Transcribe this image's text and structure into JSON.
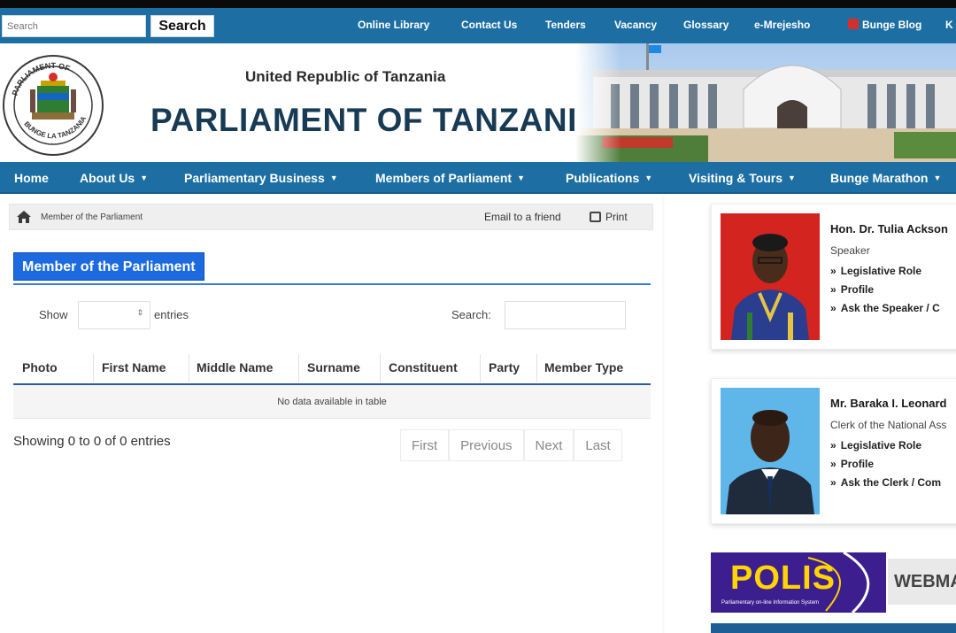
{
  "topbar": {
    "search_placeholder": "Search",
    "search_button": "Search",
    "links": [
      "Online Library",
      "Contact Us",
      "Tenders",
      "Vacancy",
      "Glossary",
      "e-Mrejesho",
      "Bunge Blog",
      "K"
    ]
  },
  "header": {
    "country": "United Republic of Tanzania",
    "title": "PARLIAMENT OF TANZANIA",
    "seal_text": "BUNGE LA TANZANIA",
    "seal_top_text": "PARLIAMENT OF"
  },
  "mainnav": {
    "items": [
      "Home",
      "About Us",
      "Parliamentary Business",
      "Members of Parliament",
      "Publications",
      "Visiting & Tours",
      "Bunge Marathon"
    ]
  },
  "breadcrumb": {
    "current": "Member of the Parliament",
    "email": "Email to a friend",
    "print": "Print"
  },
  "main": {
    "title": "Member of the Parliament",
    "show_label": "Show",
    "entries_label": "entries",
    "search_label": "Search:",
    "columns": [
      "Photo",
      "First Name",
      "Middle Name",
      "Surname",
      "Constituent",
      "Party",
      "Member Type"
    ],
    "empty_message": "No data available in table",
    "info": "Showing 0 to 0 of 0 entries",
    "pager": [
      "First",
      "Previous",
      "Next",
      "Last"
    ]
  },
  "sidebar": {
    "speaker": {
      "name": "Hon. Dr. Tulia Ackson",
      "role": "Speaker",
      "links": [
        "Legislative Role",
        "Profile",
        "Ask the Speaker / C"
      ]
    },
    "clerk": {
      "name": "Mr. Baraka I. Leonard",
      "role": "Clerk of the National Ass",
      "links": [
        "Legislative Role",
        "Profile",
        "Ask the Clerk / Com"
      ]
    },
    "polis": {
      "logo": "POLIS",
      "sub": "Parliamentary on-line Information System"
    },
    "webmail": "WEBMA"
  },
  "colors": {
    "nav_blue": "#1d6fa3",
    "title_blue": "#1d6ae0",
    "polis_purple": "#3c1e8e",
    "polis_yellow": "#ffd400"
  }
}
